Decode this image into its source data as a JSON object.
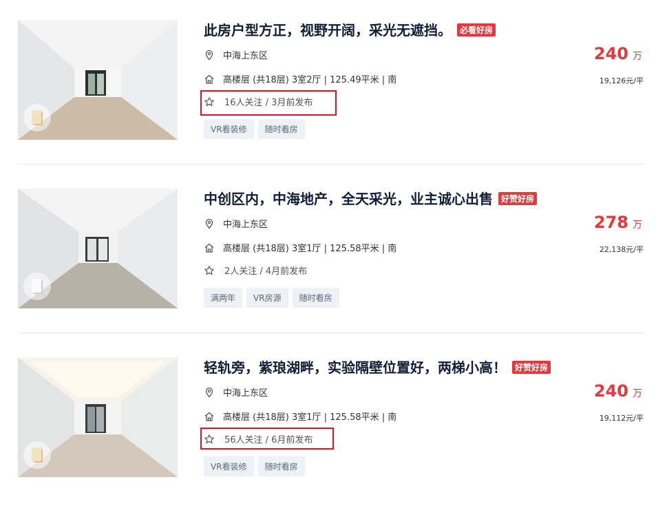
{
  "listings": [
    {
      "title": "此房户型方正，视野开阔，采光无遮挡。",
      "tag": "必看好房",
      "location": "中海上东区",
      "info": "高楼层 (共18层) 3室2厅 | 125.49平米 | 南",
      "follow": "16人关注 / 3月前发布",
      "chips": [
        "VR看装修",
        "随时看房"
      ],
      "price": "240",
      "price_unit": "万",
      "unit_price": "19,126元/平"
    },
    {
      "title": "中创区内，中海地产，全天采光，业主诚心出售",
      "tag": "好赞好房",
      "location": "中海上东区",
      "info": "高楼层 (共18层) 3室1厅 | 125.58平米 | 南",
      "follow": "2人关注 / 4月前发布",
      "chips": [
        "满两年",
        "VR房源",
        "随时看房"
      ],
      "price": "278",
      "price_unit": "万",
      "unit_price": "22,138元/平"
    },
    {
      "title": "轻轨旁，紫琅湖畔，实验隔壁位置好，两梯小高！",
      "tag": "好赞好房",
      "location": "中海上东区",
      "info": "高楼层 (共18层) 3室1厅 | 125.58平米 | 南",
      "follow": "56人关注 / 6月前发布",
      "chips": [
        "VR看装修",
        "随时看房"
      ],
      "price": "240",
      "price_unit": "万",
      "unit_price": "19,112元/平"
    }
  ],
  "colors": {
    "accent_red": "#e4393c",
    "highlight_box": "#e0121a",
    "title": "#101d37"
  },
  "icons": {
    "location": "map-pin-icon",
    "house": "house-icon",
    "follow": "star-icon",
    "vr": "vr-badge-icon"
  }
}
